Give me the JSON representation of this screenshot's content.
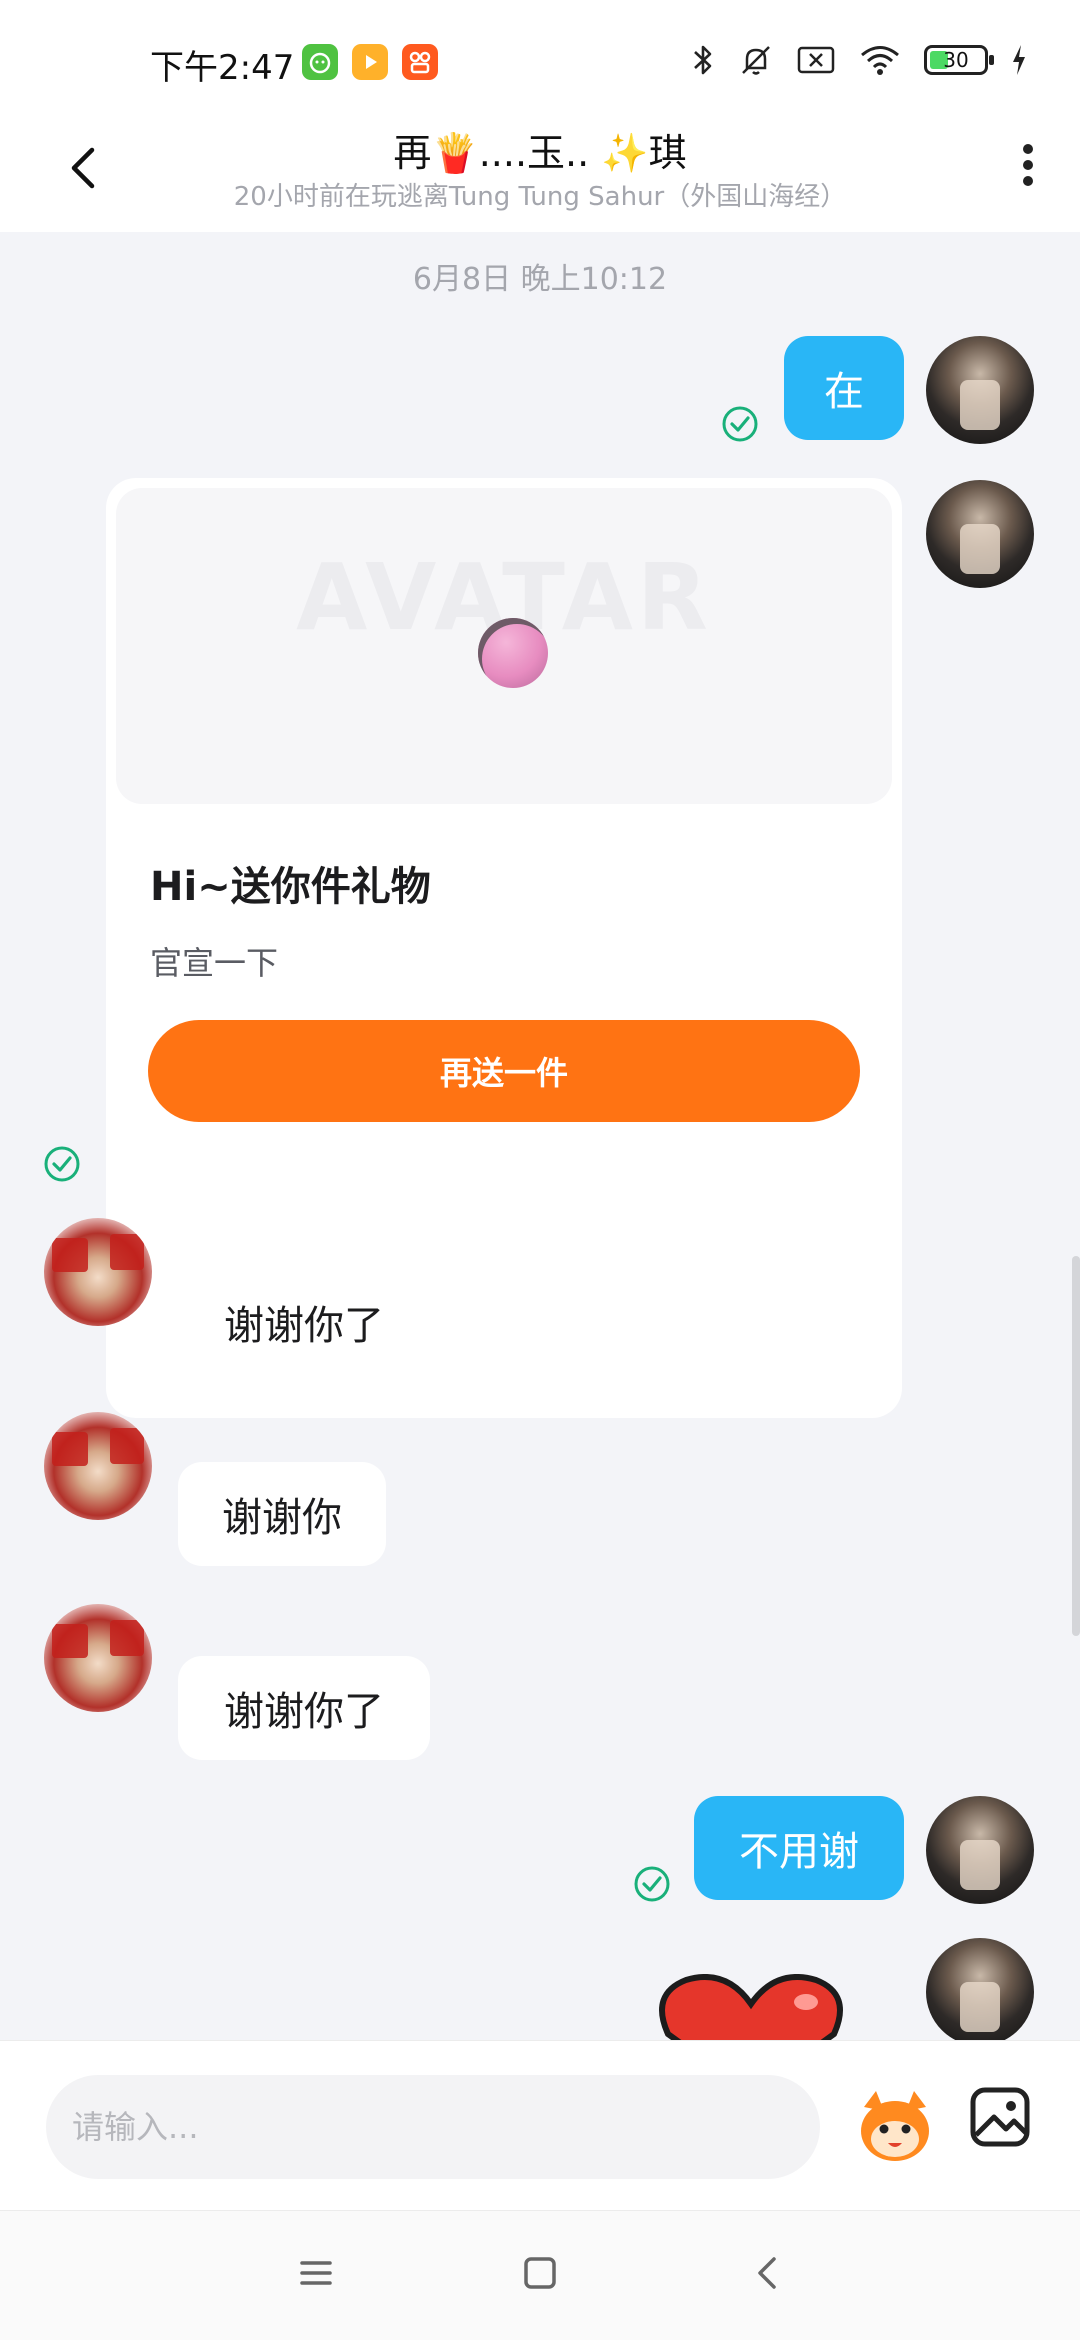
{
  "status_bar": {
    "time": "下午2:47",
    "battery_level": "30",
    "icons": [
      "app-icon-green",
      "app-icon-orange-video",
      "app-icon-orange",
      "bluetooth-icon",
      "mute-icon",
      "no-sim-icon",
      "wifi-icon",
      "battery-icon",
      "charging-icon"
    ]
  },
  "header": {
    "title": "再🍟....玉..  ✨琪",
    "subtitle": "20小时前在玩逃离Tung Tung Sahur（外国山海经）"
  },
  "chat": {
    "timestamp": "6月8日 晚上10:12",
    "messages": [
      {
        "from": "me",
        "text": "在"
      },
      {
        "from": "me",
        "type": "gift",
        "banner_text": "AVATAR",
        "title": "Hi~送你件礼物",
        "description": "官宣一下",
        "button_label": "再送一件"
      },
      {
        "from": "other",
        "text": "谢谢你了"
      },
      {
        "from": "other",
        "text": "谢谢你"
      },
      {
        "from": "other",
        "text": "谢谢你了"
      },
      {
        "from": "me",
        "text": "不用谢"
      },
      {
        "from": "me",
        "type": "sticker",
        "sticker": "heart-sticker"
      }
    ]
  },
  "input": {
    "placeholder": "请输入..."
  },
  "colors": {
    "accent_blue": "#29b6f6",
    "gift_button": "#ff7313",
    "read_check": "#19b07a",
    "background": "#f3f4f8"
  }
}
